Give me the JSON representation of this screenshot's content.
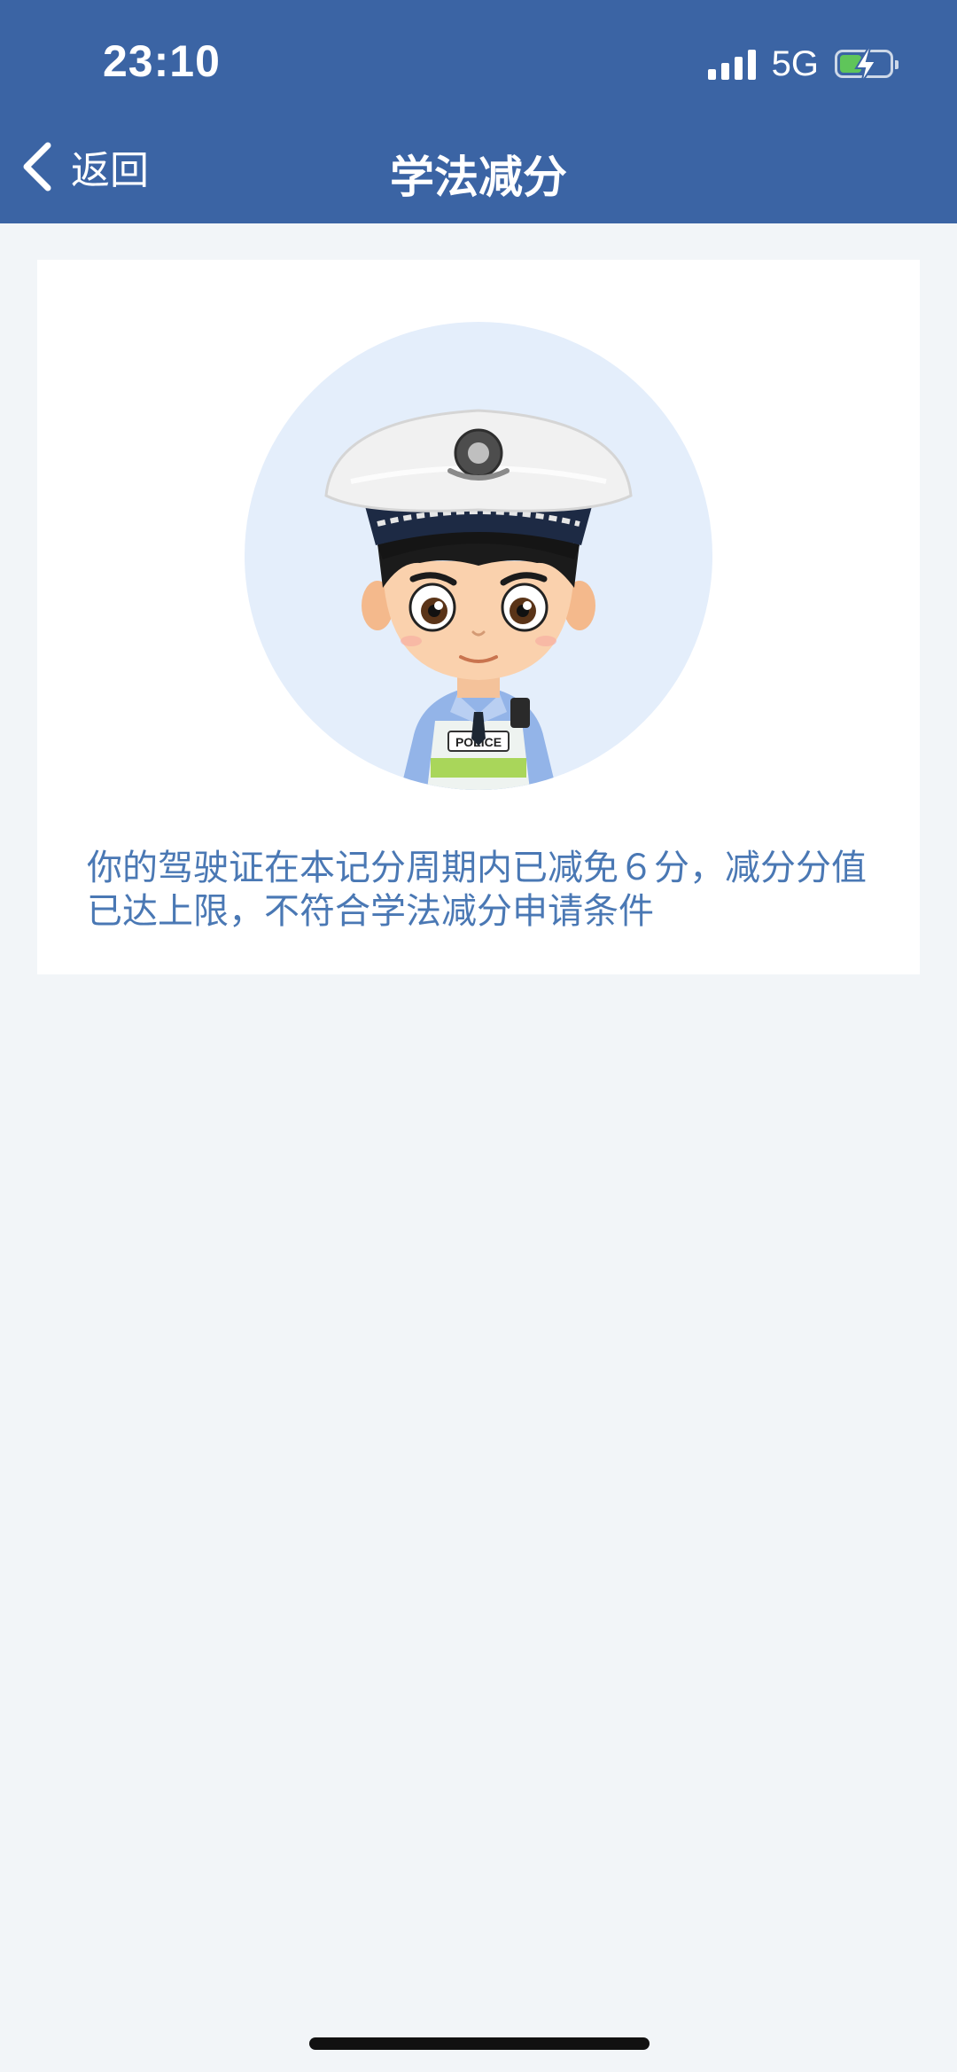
{
  "status_bar": {
    "time": "23:10",
    "network": "5G",
    "signal_bars": 4,
    "battery_level": 0.45,
    "battery_charging": true
  },
  "nav": {
    "back_label": "返回",
    "title": "学法减分"
  },
  "card": {
    "avatar_icon": "police-officer-avatar",
    "badge_text": "POLICE",
    "message": "你的驾驶证在本记分周期内已减免６分，减分分值已达上限，不符合学法减分申请条件"
  },
  "colors": {
    "header": "#3b64a4",
    "background": "#f2f5f8",
    "message_text": "#4a78b4",
    "avatar_bg": "#e4eefb"
  }
}
